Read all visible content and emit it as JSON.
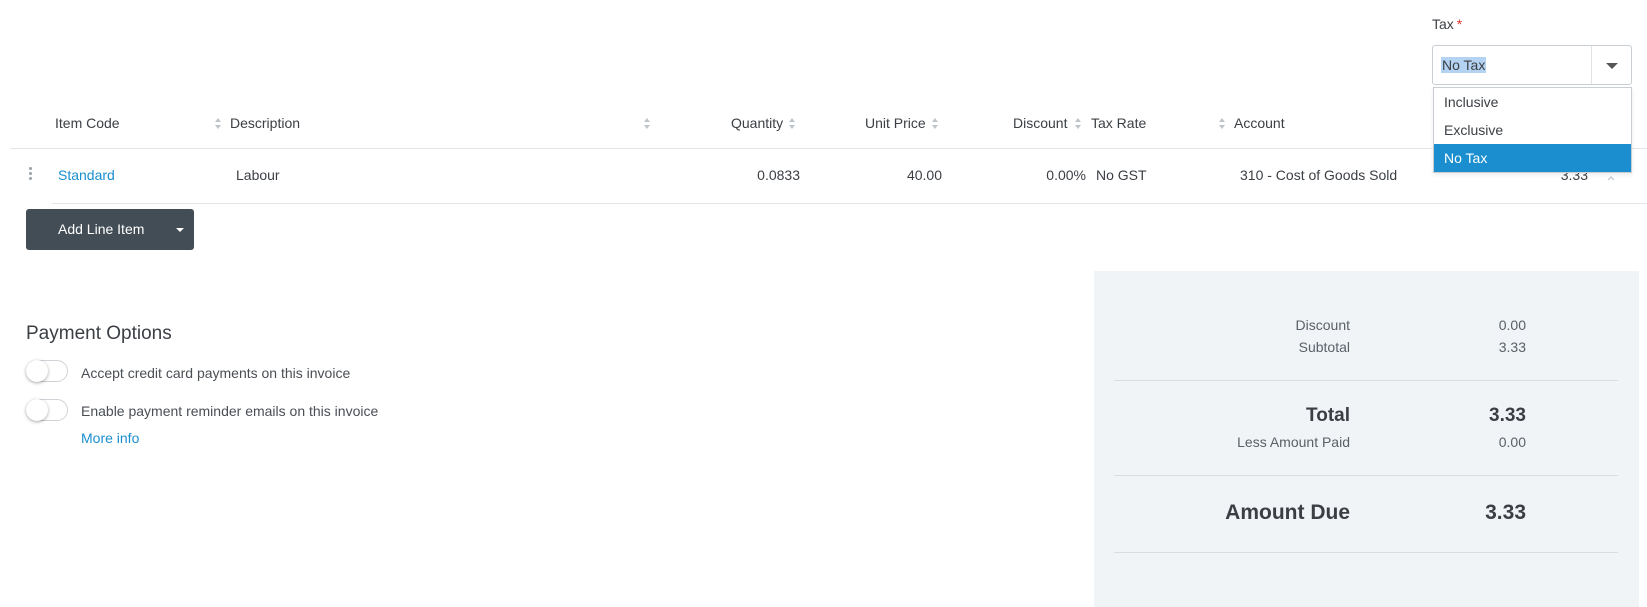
{
  "tax": {
    "label": "Tax",
    "required_marker": "*",
    "selected": "No Tax",
    "options": [
      "Inclusive",
      "Exclusive",
      "No Tax"
    ]
  },
  "table": {
    "headers": [
      "Item Code",
      "Description",
      "Quantity",
      "Unit Price",
      "Discount",
      "Tax Rate",
      "Account"
    ],
    "row": {
      "item_code": "Standard",
      "description": "Labour",
      "quantity": "0.0833",
      "unit_price": "40.00",
      "discount": "0.00%",
      "tax_rate": "No GST",
      "account": "310 - Cost of Goods Sold",
      "amount": "3.33"
    }
  },
  "add_line_item": {
    "label": "Add Line Item"
  },
  "payment_options": {
    "title": "Payment Options",
    "credit_card_label": "Accept credit card payments on this invoice",
    "reminder_label": "Enable payment reminder emails on this invoice",
    "more_info": "More info",
    "credit_card_enabled": false,
    "reminder_enabled": false
  },
  "totals": {
    "discount_label": "Discount",
    "discount_value": "0.00",
    "subtotal_label": "Subtotal",
    "subtotal_value": "3.33",
    "total_label": "Total",
    "total_value": "3.33",
    "less_paid_label": "Less Amount Paid",
    "less_paid_value": "0.00",
    "amount_due_label": "Amount Due",
    "amount_due_value": "3.33"
  },
  "colors": {
    "accent": "#1a8ecf",
    "button": "#434d55",
    "panel": "#f1f4f6",
    "required": "#d9342b"
  }
}
